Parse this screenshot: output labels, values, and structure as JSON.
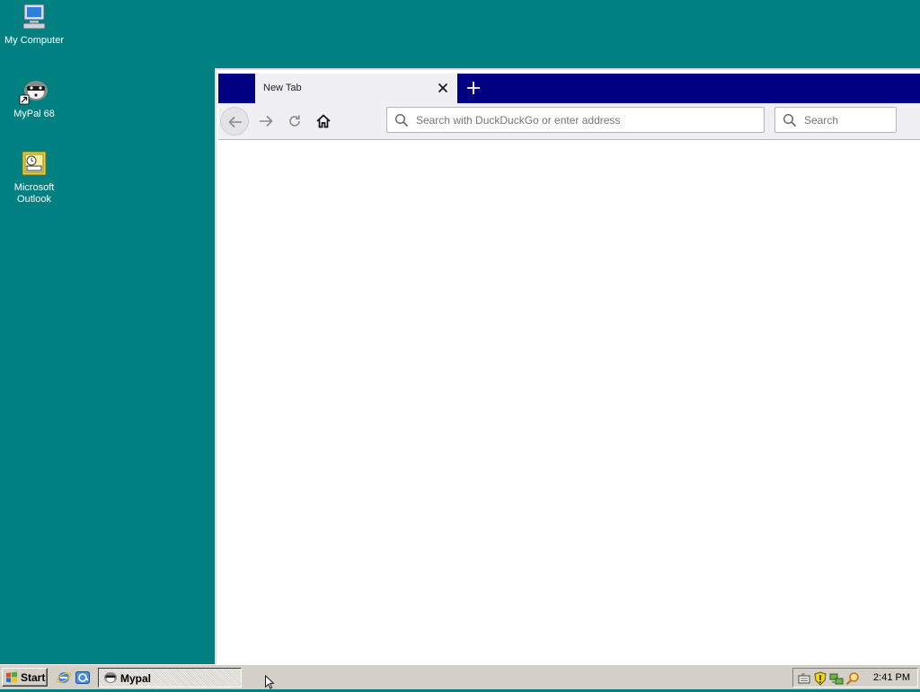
{
  "desktop": {
    "icons": [
      {
        "label": "My Computer",
        "icon": "my-computer-icon"
      },
      {
        "label": "MyPal 68",
        "icon": "mypal-shortcut-icon"
      },
      {
        "label": "Microsoft\nOutlook",
        "icon": "outlook-icon"
      }
    ],
    "background_color": "#008080"
  },
  "browser": {
    "tab": {
      "title": "New Tab",
      "close_icon": "close-icon"
    },
    "new_tab_icon": "plus-icon",
    "nav": {
      "back_icon": "back-arrow-icon",
      "forward_icon": "forward-arrow-icon",
      "reload_icon": "reload-icon",
      "home_icon": "home-icon"
    },
    "urlbar": {
      "placeholder": "Search with DuckDuckGo or enter address",
      "value": ""
    },
    "searchbar": {
      "placeholder": "Search",
      "value": ""
    },
    "tabstrip_color": "#000080"
  },
  "taskbar": {
    "start_label": "Start",
    "quick_launch": [
      "ie-icon",
      "outlook-express-icon"
    ],
    "tasks": [
      {
        "label": "Mypal",
        "icon": "mypal-icon"
      }
    ],
    "tray_icons": [
      "keyboard-icon",
      "security-shield-icon",
      "network-icon",
      "search-icon"
    ],
    "clock": "2:41 PM"
  }
}
